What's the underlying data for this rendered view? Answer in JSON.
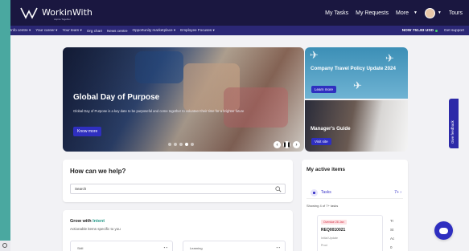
{
  "header": {
    "brand": "WorkinWith",
    "brand_tagline": "Aspire Together",
    "links": [
      "My Tasks",
      "My Requests"
    ],
    "more": "More",
    "tours": "Tours"
  },
  "nav": {
    "items": [
      "Info centre ▾",
      "Your career ▾",
      "Your team ▾",
      "Org chart",
      "News centre",
      "Opportunity marketplace ▾",
      "Employee Focuses ▾"
    ],
    "now": "NOW 751.83 USD",
    "support": "Get support"
  },
  "hero": {
    "title": "Global Day of Purpose",
    "description": "Global Day of Purpose is a key date to be purposeful and come together to volunteer their time for a brighter future",
    "button": "Know more",
    "slide_count": 5,
    "active_slide": 3
  },
  "side_cards": {
    "travel": {
      "title": "Company Travel Policy Update 2024",
      "button": "Learn more"
    },
    "guide": {
      "title": "Manager's Guide",
      "button": "Visit site"
    }
  },
  "help": {
    "title": "How can we help?",
    "search_value": "Search"
  },
  "grow": {
    "title_prefix": "Grow with",
    "title_accent": "Intent",
    "subtitle": "Actionable items specific to you",
    "cards": [
      {
        "label": "Skill",
        "meta": "▪ ▪"
      },
      {
        "label": "Learning",
        "meta": "▪ ▪"
      }
    ]
  },
  "active": {
    "title": "My active items",
    "tasks_label": "Tasks",
    "tasks_count": "7+ ›",
    "showing": "Showing 4 of 7+ tasks",
    "task": {
      "status": "Overdue 28 Jan",
      "id": "REQ0010021",
      "meta1": "Initial Update",
      "meta2": "Prod"
    },
    "side_chars": [
      "Tr",
      "St",
      "Ac",
      "0"
    ]
  },
  "feedback": "Give feedback",
  "colors": {
    "topbar": "#1a1740",
    "navbar": "#2b2775",
    "accent": "#2f2fc0",
    "teal_frame": "#4aa8a0",
    "overdue": "#d23045"
  },
  "icons": [
    "logo-mark",
    "avatar",
    "search-icon",
    "chat-icon",
    "plane-icon"
  ]
}
